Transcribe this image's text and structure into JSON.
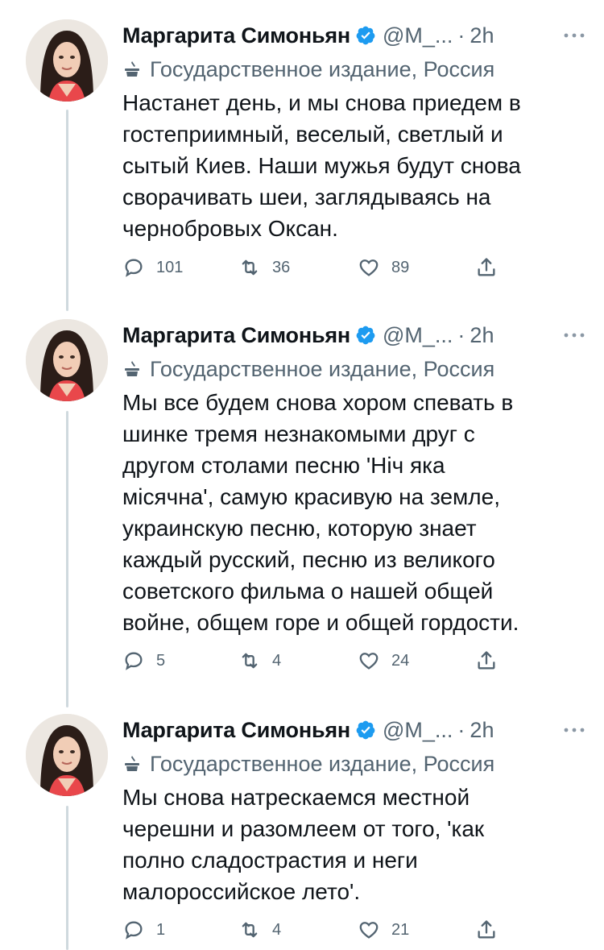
{
  "tweets": [
    {
      "author_name": "Маргарита Симоньян",
      "handle": "@М_...",
      "separator": "·",
      "time": "2h",
      "label": "Государственное издание, Россия",
      "text": "Настанет день, и мы снова приедем в\nгостеприимный, веселый, светлый и\nсытый Киев. Наши мужья будут снова\nсворачивать шеи, заглядываясь на\nчернобровых Оксан.",
      "replies": "101",
      "retweets": "36",
      "likes": "89"
    },
    {
      "author_name": "Маргарита Симоньян",
      "handle": "@М_...",
      "separator": "·",
      "time": "2h",
      "label": "Государственное издание, Россия",
      "text": "Мы все будем снова хором спевать в\nшинке тремя незнакомыми друг с\nдругом столами песню 'Ніч яка\nмісячна', самую красивую на земле,\nукраинскую песню, которую знает\nкаждый русский, песню из великого\nсоветского фильма о нашей общей\nвойне, общем горе и общей гордости.",
      "replies": "5",
      "retweets": "4",
      "likes": "24"
    },
    {
      "author_name": "Маргарита Симоньян",
      "handle": "@М_...",
      "separator": "·",
      "time": "2h",
      "label": "Государственное издание, Россия",
      "text": "Мы снова натрескаемся местной\nчерешни и разомлеем от того, 'как\nполно сладострастия и неги\nмалороссийское лето'.",
      "replies": "1",
      "retweets": "4",
      "likes": "21"
    }
  ],
  "colors": {
    "text": "#0f1419",
    "secondary": "#536471",
    "verified": "#1d9bf0",
    "thread_line": "#cfd9de"
  },
  "icons": {
    "verified": "verified-badge-icon",
    "label": "state-media-icon",
    "more": "more-options-icon",
    "reply": "reply-icon",
    "retweet": "retweet-icon",
    "like": "heart-icon",
    "share": "share-icon"
  }
}
